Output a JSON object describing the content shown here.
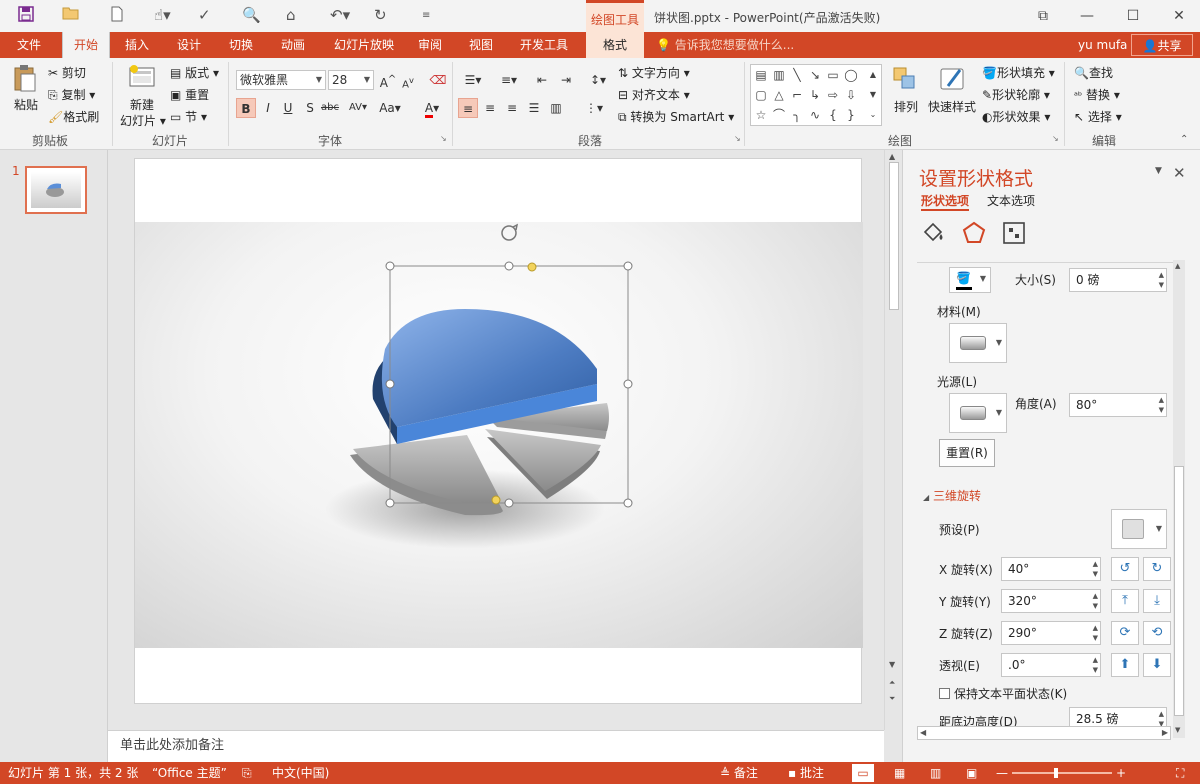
{
  "window": {
    "title": "饼状图.pptx - PowerPoint(产品激活失败)",
    "context_tab_title": "绘图工具",
    "controls": [
      "minimize",
      "maximize",
      "close"
    ]
  },
  "qat": [
    "save-icon",
    "open-icon",
    "new-icon",
    "touch-icon",
    "spelling-icon",
    "print-preview-icon",
    "presenter-icon",
    "undo-icon",
    "redo-icon",
    "customize-icon"
  ],
  "tabs": [
    "文件",
    "开始",
    "插入",
    "设计",
    "切换",
    "动画",
    "幻灯片放映",
    "审阅",
    "视图",
    "开发工具",
    "格式"
  ],
  "tellme": "告诉我您想要做什么...",
  "user": "yu mufa",
  "share": "共享",
  "ribbon": {
    "clipboard": {
      "paste": "粘贴",
      "cut": "剪切",
      "copy": "复制",
      "format_painter": "格式刷",
      "label": "剪贴板"
    },
    "slides": {
      "new_slide_1": "新建",
      "new_slide_2": "幻灯片",
      "layout": "版式",
      "reset": "重置",
      "section": "节",
      "label": "幻灯片"
    },
    "font": {
      "name": "微软雅黑",
      "size": "28",
      "label": "字体",
      "bold": "B",
      "italic": "I",
      "underline": "U",
      "shadow": "S",
      "strike": "abc",
      "spacing": "AV",
      "case": "Aa",
      "color": "A",
      "grow": "A",
      "shrink": "A"
    },
    "paragraph": {
      "text_direction": "文字方向",
      "align_text": "对齐文本",
      "smartart": "转换为 SmartArt",
      "label": "段落"
    },
    "drawing": {
      "arrange": "排列",
      "quick_styles": "快速样式",
      "fill": "形状填充",
      "outline": "形状轮廓",
      "effects": "形状效果",
      "label": "绘图"
    },
    "editing": {
      "find": "查找",
      "replace": "替换",
      "select": "选择",
      "label": "编辑"
    }
  },
  "thumbnails": [
    {
      "number": "1"
    }
  ],
  "notes_placeholder": "单击此处添加备注",
  "pane": {
    "title": "设置形状格式",
    "tab_shape": "形状选项",
    "tab_text": "文本选项",
    "size_label": "大小(S)",
    "size_value": "0 磅",
    "material_label": "材料(M)",
    "lighting_label": "光源(L)",
    "angle_label": "角度(A)",
    "angle_value": "80°",
    "reset": "重置(R)",
    "rotation_section": "三维旋转",
    "preset_label": "预设(P)",
    "x_label": "X 旋转(X)",
    "x_value": "40°",
    "y_label": "Y 旋转(Y)",
    "y_value": "320°",
    "z_label": "Z 旋转(Z)",
    "z_value": "290°",
    "perspective_label": "透视(E)",
    "perspective_value": ".0°",
    "keep_flat_label": "保持文本平面状态(K)",
    "distance_label": "距底边高度(D)",
    "distance_value": "28.5 磅"
  },
  "status": {
    "slide_info": "幻灯片 第 1 张，共 2 张",
    "theme": "“Office 主题”",
    "language": "中文(中国)",
    "notes": "备注",
    "comments": "批注",
    "zoom_level": 0.7
  },
  "colors": {
    "accent": "#d24726",
    "pie_blue": "#5b8fd8",
    "pie_gray": "#a6a6a6"
  }
}
